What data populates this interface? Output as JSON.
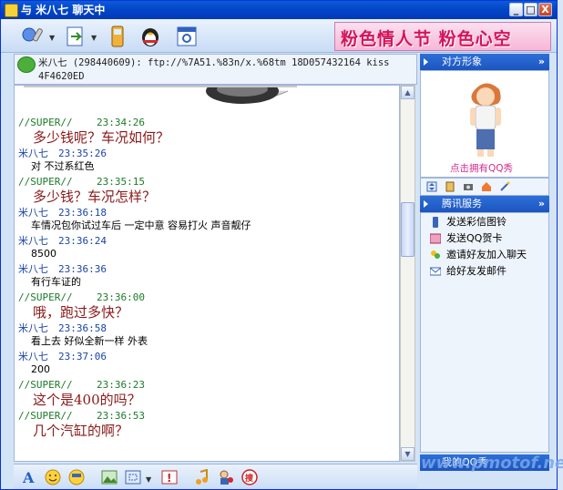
{
  "window": {
    "title": "与 米八七 聊天中",
    "buttons": [
      "_",
      "□",
      "X"
    ]
  },
  "toolbar": {
    "icons": [
      "microphone-icon",
      "file-transfer-icon",
      "mobile-phone-icon",
      "penguin-icon",
      "window-settings-icon"
    ],
    "banner_text": "粉色情人节 粉色心空"
  },
  "contact_info": {
    "text": "米八七 (298440609): ftp://%7A51.%83n/x.%68tm 18D057432164  kiss 4F4620ED"
  },
  "messages": [
    {
      "sender": "//SUPER//",
      "time": "23:34:26",
      "text": "多少钱呢？车况如何？",
      "style": "big",
      "head": "super"
    },
    {
      "sender": "米八七",
      "time": "23:35:26",
      "text": "对 不过系红色",
      "style": "normal",
      "head": "mine"
    },
    {
      "sender": "//SUPER//",
      "time": "23:35:15",
      "text": "多少钱？车况怎样？",
      "style": "big",
      "head": "super"
    },
    {
      "sender": "米八七",
      "time": "23:36:18",
      "text": "车情况包你试过车后 一定中意 容易打火 声音靓仔",
      "style": "normal",
      "head": "mine"
    },
    {
      "sender": "米八七",
      "time": "23:36:24",
      "text": "8500",
      "style": "normal",
      "head": "mine"
    },
    {
      "sender": "米八七",
      "time": "23:36:36",
      "text": "有行车证的",
      "style": "normal",
      "head": "mine"
    },
    {
      "sender": "//SUPER//",
      "time": "23:36:00",
      "text": "哦，跑过多快？",
      "style": "big",
      "head": "super"
    },
    {
      "sender": "米八七",
      "time": "23:36:58",
      "text": "看上去 好似全新一样 外表",
      "style": "normal",
      "head": "mine"
    },
    {
      "sender": "米八七",
      "time": "23:37:06",
      "text": "200",
      "style": "normal",
      "head": "mine"
    },
    {
      "sender": "//SUPER//",
      "time": "23:36:23",
      "text": "这个是400的吗？",
      "style": "big",
      "head": "super"
    },
    {
      "sender": "//SUPER//",
      "time": "23:36:53",
      "text": "几个汽缸的啊？",
      "style": "big",
      "head": "super"
    }
  ],
  "sidebar": {
    "show_panel_title": "对方形象",
    "show_text": "点击拥有QQ秀",
    "services_title": "腾讯服务",
    "services": [
      "发送彩信图铃",
      "发送QQ贺卡",
      "邀请好友加入聊天",
      "给好友发邮件"
    ],
    "myqq_title": "我的QQ秀",
    "chevron": "»"
  },
  "watermark": "www.pmotof.net"
}
